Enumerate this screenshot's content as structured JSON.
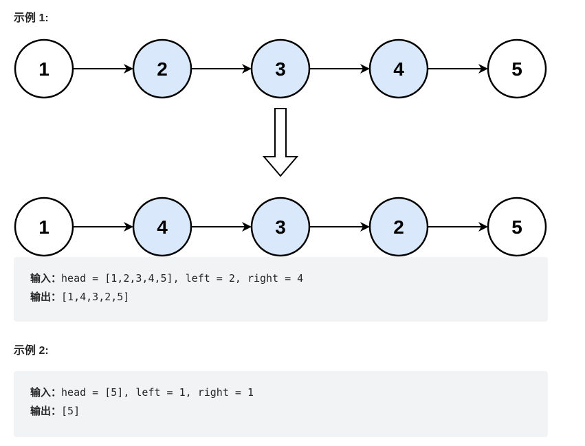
{
  "example1": {
    "heading": "示例 1:",
    "before": [
      {
        "value": "1",
        "highlight": false
      },
      {
        "value": "2",
        "highlight": true
      },
      {
        "value": "3",
        "highlight": true
      },
      {
        "value": "4",
        "highlight": true
      },
      {
        "value": "5",
        "highlight": false
      }
    ],
    "after": [
      {
        "value": "1",
        "highlight": false
      },
      {
        "value": "4",
        "highlight": true
      },
      {
        "value": "3",
        "highlight": true
      },
      {
        "value": "2",
        "highlight": true
      },
      {
        "value": "5",
        "highlight": false
      }
    ],
    "input_label": "输入：",
    "input": "head = [1,2,3,4,5], left = 2, right = 4",
    "output_label": "输出：",
    "output": "[1,4,3,2,5]"
  },
  "example2": {
    "heading": "示例 2:",
    "input_label": "输入：",
    "input": "head = [5], left = 1, right = 1",
    "output_label": "输出：",
    "output": "[5]"
  },
  "colors": {
    "highlight": "#dae8fc",
    "normal": "#ffffff",
    "stroke": "#000000",
    "code_bg": "#f2f3f5"
  }
}
